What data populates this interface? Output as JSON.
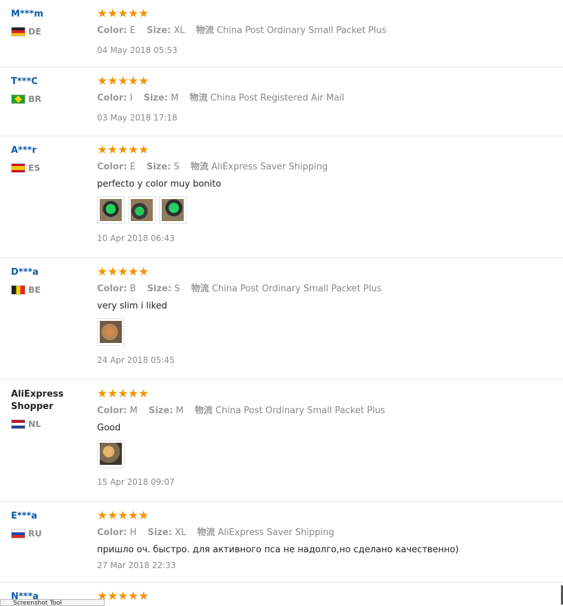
{
  "labels": {
    "color": "Color:",
    "size": "Size:",
    "shipping": "物流"
  },
  "reviews": [
    {
      "buyer": "M***m",
      "country": "DE",
      "color": "E",
      "size": "XL",
      "shipping": "China Post Ordinary Small Packet Plus",
      "feedback": "",
      "photos": 0,
      "date": "04 May 2018 05:53"
    },
    {
      "buyer": "T***C",
      "country": "BR",
      "color": "I",
      "size": "M",
      "shipping": "China Post Registered Air Mail",
      "feedback": "",
      "photos": 0,
      "date": "03 May 2018 17:18"
    },
    {
      "buyer": "A***r",
      "country": "ES",
      "color": "E",
      "size": "S",
      "shipping": "AliExpress Saver Shipping",
      "feedback": "perfecto y color muy bonito",
      "photos": 3,
      "date": "10 Apr 2018 06:43"
    },
    {
      "buyer": "D***a",
      "country": "BE",
      "color": "B",
      "size": "S",
      "shipping": "China Post Ordinary Small Packet Plus",
      "feedback": "very slim i liked",
      "photos": 1,
      "date": "24 Apr 2018 05:45"
    },
    {
      "buyer": "AliExpress Shopper",
      "country": "NL",
      "color": "M",
      "size": "M",
      "shipping": "China Post Ordinary Small Packet Plus",
      "feedback": "Good",
      "photos": 1,
      "date": "15 Apr 2018 09:07"
    },
    {
      "buyer": "E***a",
      "country": "RU",
      "color": "H",
      "size": "XL",
      "shipping": "AliExpress Saver Shipping",
      "feedback": "пришло оч. быстро. для активного пса не надолго,но сделано качественно)",
      "photos": 0,
      "date": "27 Mar 2018 22:33"
    },
    {
      "buyer": "N***a",
      "rating": 5
    }
  ],
  "rating_max": 5,
  "star_color": "#f39200",
  "name_color": "#0a5aa8",
  "tooltip_text": "Screenshot Tool"
}
